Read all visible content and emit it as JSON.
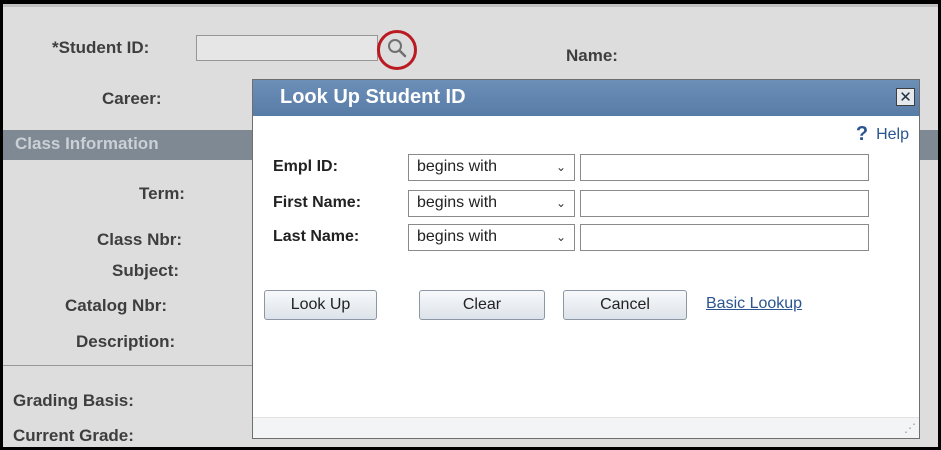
{
  "background": {
    "student_id_label": "*Student ID:",
    "name_label": "Name:",
    "career_label": "Career:",
    "section_title": "Class Information",
    "term_label": "Term:",
    "class_nbr_label": "Class Nbr:",
    "subject_label": "Subject:",
    "catalog_nbr_label": "Catalog Nbr:",
    "description_label": "Description:",
    "grading_basis_label": "Grading Basis:",
    "current_grade_label": "Current Grade:"
  },
  "modal": {
    "title": "Look Up Student ID",
    "close_glyph": "✕",
    "help_glyph": "?",
    "help_label": "Help",
    "fields": [
      {
        "label": "Empl ID:",
        "operator": "begins with",
        "value": ""
      },
      {
        "label": "First Name:",
        "operator": "begins with",
        "value": ""
      },
      {
        "label": "Last Name:",
        "operator": "begins with",
        "value": ""
      }
    ],
    "buttons": {
      "look_up": "Look Up",
      "clear": "Clear",
      "cancel": "Cancel"
    },
    "basic_lookup_link": "Basic Lookup"
  },
  "colors": {
    "modal_header": "#577ca6",
    "highlight_ring": "#c0141c",
    "link": "#2a5590"
  }
}
